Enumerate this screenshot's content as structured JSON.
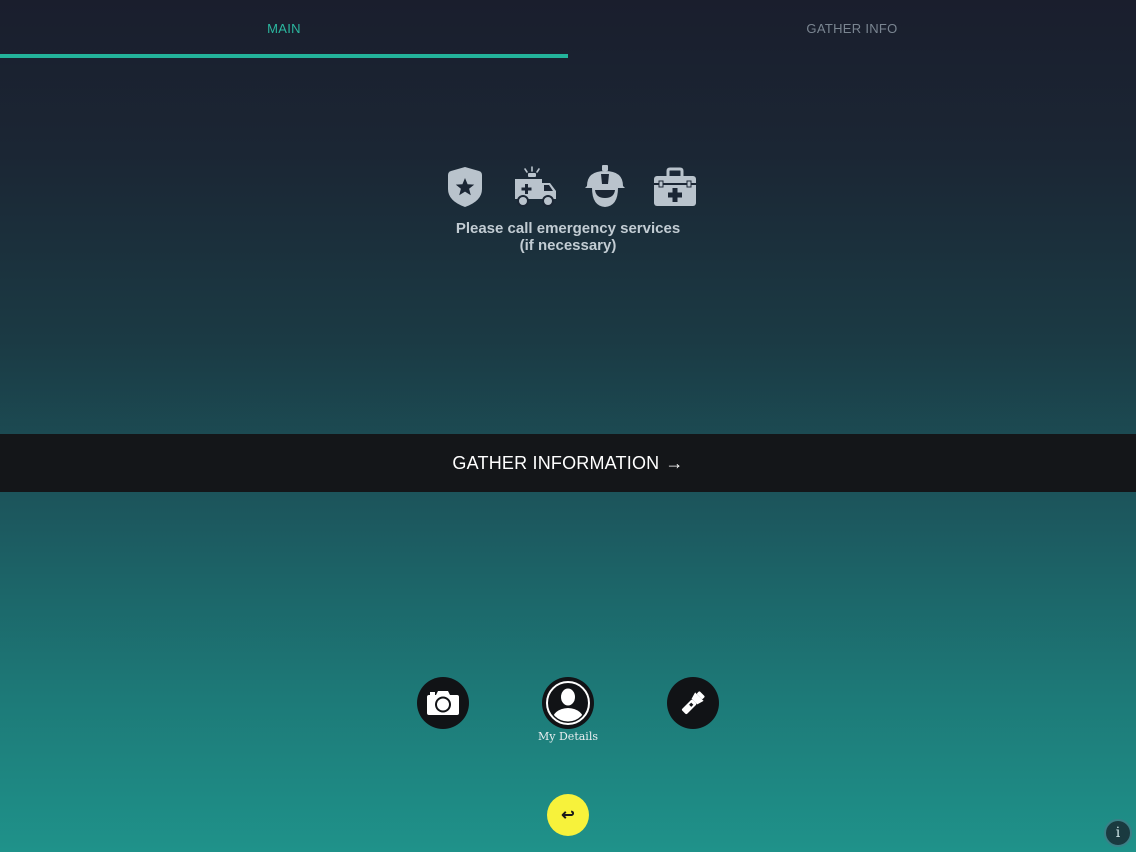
{
  "tabs": [
    {
      "label": "MAIN",
      "active": true
    },
    {
      "label": "GATHER INFO",
      "active": false
    }
  ],
  "colors": {
    "accent": "#23b39b",
    "inactive_tab": "#7a8591",
    "bar_background": "#141619",
    "back_button": "#f7f23b",
    "icon_gray": "#b9c3cc"
  },
  "services": {
    "icons": [
      "police-badge-icon",
      "ambulance-icon",
      "firefighter-helmet-icon",
      "first-aid-kit-icon"
    ],
    "notice_line1": "Please call emergency services",
    "notice_line2": "(if necessary)"
  },
  "gather_bar": {
    "label": "GATHER INFORMATION",
    "arrow": "→"
  },
  "actions": [
    {
      "icon": "camera-icon",
      "label": ""
    },
    {
      "icon": "user-silhouette-icon",
      "label": "My Details"
    },
    {
      "icon": "flashlight-icon",
      "label": ""
    }
  ],
  "back_button": {
    "glyph": "↩"
  },
  "info_button": {
    "glyph": "i"
  }
}
